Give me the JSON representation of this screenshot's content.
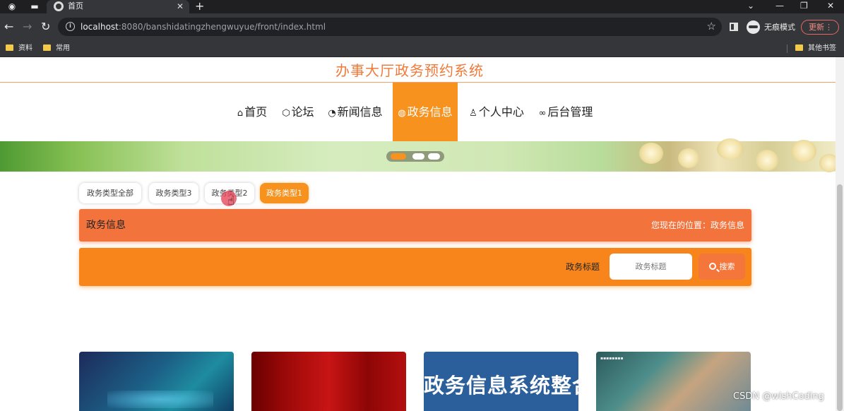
{
  "browser": {
    "tab_title": "首页",
    "url_host": "localhost",
    "url_rest": ":8080/banshidatingzhengwuyue/front/index.html",
    "incognito_label": "无痕模式",
    "update_label": "更新",
    "bookmarks": [
      "资料",
      "常用"
    ],
    "other_bookmarks": "其他书签"
  },
  "site": {
    "title": "办事大厅政务预约系统"
  },
  "nav": {
    "items": [
      {
        "label": "首页",
        "icon": "home-icon"
      },
      {
        "label": "论坛",
        "icon": "cube-icon"
      },
      {
        "label": "新闻信息",
        "icon": "dashboard-icon"
      },
      {
        "label": "政务信息",
        "icon": "globe-icon",
        "active": true
      },
      {
        "label": "个人中心",
        "icon": "user-icon"
      },
      {
        "label": "后台管理",
        "icon": "link-icon"
      }
    ]
  },
  "carousel": {
    "slide_count": 3,
    "active_index": 0
  },
  "filters": {
    "chips": [
      "政务类型全部",
      "政务类型3",
      "政务类型2",
      "政务类型1"
    ],
    "active": "政务类型1"
  },
  "breadcrumb": {
    "title": "政务信息",
    "location": "您现在的位置：政务信息"
  },
  "search": {
    "label": "政务标题",
    "placeholder": "政务标题",
    "button": "搜索"
  },
  "cards": [
    {
      "image": "blue-tech"
    },
    {
      "image": "red-gradient"
    },
    {
      "image": "text-banner",
      "text": "政务信息系统整合共享"
    },
    {
      "image": "hand-tech"
    }
  ],
  "watermark": "CSDN @wishCoding",
  "colors": {
    "accent": "#f7921e",
    "breadcrumb": "#f3733d",
    "title": "#f07a3a"
  }
}
